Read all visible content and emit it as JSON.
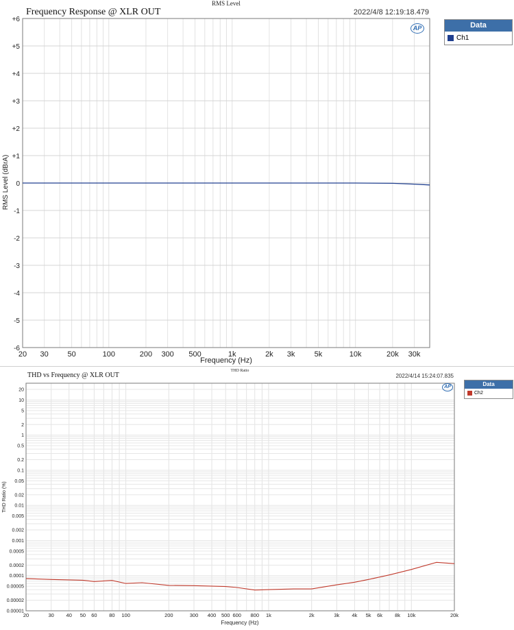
{
  "chart_data": [
    {
      "type": "line",
      "suptitle": "RMS Level",
      "title": "Frequency Response @ XLR OUT",
      "timestamp": "2022/4/8 12:19:18.479",
      "xlabel": "Frequency (Hz)",
      "ylabel": "RMS Level (dBrA)",
      "xscale": "log",
      "xlim": [
        20,
        40000
      ],
      "ylim": [
        -6,
        6
      ],
      "grid": true,
      "legend_position": "right, outside plot, top",
      "legend_title": "Data",
      "xticks": [
        "20",
        "30",
        "50",
        "100",
        "200",
        "300",
        "500",
        "1k",
        "2k",
        "3k",
        "5k",
        "10k",
        "20k",
        "30k"
      ],
      "yticks": [
        "+6",
        "+5",
        "+4",
        "+3",
        "+2",
        "+1",
        "0",
        "-1",
        "-2",
        "-3",
        "-4",
        "-5",
        "-6"
      ],
      "series": [
        {
          "name": "Ch1",
          "color": "#1f3f8f",
          "x": [
            20,
            50,
            100,
            1000,
            10000,
            20000,
            30000,
            40000
          ],
          "y": [
            0.0,
            0.0,
            0.0,
            0.0,
            0.0,
            -0.01,
            -0.04,
            -0.07
          ]
        }
      ]
    },
    {
      "type": "line",
      "suptitle": "THD Ratio",
      "title": "THD vs Frequency @ XLR OUT",
      "timestamp": "2022/4/14 15:24:07.835",
      "xlabel": "Frequency (Hz)",
      "ylabel": "THD Ratio (%)",
      "xscale": "log",
      "yscale": "log",
      "xlim": [
        20,
        20000
      ],
      "ylim": [
        1e-05,
        30
      ],
      "grid": true,
      "legend_position": "right, outside plot, top",
      "legend_title": "Data",
      "xticks": [
        "20",
        "30",
        "40",
        "50",
        "60",
        "80",
        "100",
        "200",
        "300",
        "400",
        "500",
        "600",
        "800",
        "1k",
        "2k",
        "3k",
        "4k",
        "5k",
        "6k",
        "8k",
        "10k",
        "20k"
      ],
      "yticks": [
        "20",
        "10",
        "5",
        "2",
        "1",
        "0.5",
        "0.2",
        "0.1",
        "0.05",
        "0.02",
        "0.01",
        "0.005",
        "0.002",
        "0.001",
        "0.0005",
        "0.0002",
        "0.0001",
        "0.00005",
        "0.00002",
        "0.00001"
      ],
      "series": [
        {
          "name": "Ch2",
          "color": "#c0392b",
          "x": [
            20,
            30,
            50,
            60,
            80,
            100,
            130,
            200,
            300,
            500,
            600,
            800,
            1000,
            1500,
            2000,
            3000,
            4000,
            5000,
            7000,
            10000,
            15000,
            20000
          ],
          "y": [
            8.3e-05,
            7.8e-05,
            7.4e-05,
            6.8e-05,
            7.3e-05,
            6e-05,
            6.3e-05,
            5.3e-05,
            5.2e-05,
            4.9e-05,
            4.6e-05,
            3.9e-05,
            4e-05,
            4.2e-05,
            4.2e-05,
            5.5e-05,
            6.5e-05,
            7.8e-05,
            0.000105,
            0.00015,
            0.00024,
            0.00022
          ]
        }
      ]
    }
  ]
}
